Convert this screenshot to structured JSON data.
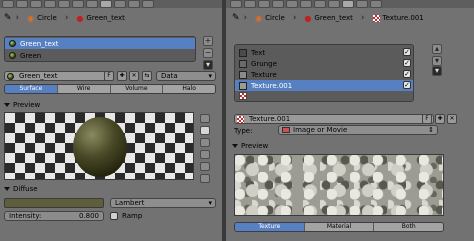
{
  "left_panel": {
    "breadcrumb": {
      "object": "Circle",
      "material": "Green_text"
    },
    "material_slots": [
      {
        "name": "Green_text",
        "selected": true
      },
      {
        "name": "Green",
        "selected": false
      }
    ],
    "material_field": {
      "name": "Green_text",
      "fake_user_label": "F",
      "data_dropdown": "Data"
    },
    "render_tabs": [
      "Surface",
      "Wire",
      "Volume",
      "Halo"
    ],
    "active_render_tab": "Surface",
    "preview_section": "Preview",
    "diffuse_section": "Diffuse",
    "diffuse_shader": "Lambert",
    "intensity_label": "Intensity:",
    "intensity_value": "0.800",
    "ramp_label": "Ramp",
    "diffuse_color": "#5e5e3c"
  },
  "right_panel": {
    "breadcrumb": {
      "object": "Circle",
      "material": "Green_text",
      "texture": "Texture.001"
    },
    "texture_slots": [
      {
        "name": "Text",
        "checked": true,
        "selected": false
      },
      {
        "name": "Grunge",
        "checked": true,
        "selected": false
      },
      {
        "name": "Texture",
        "checked": true,
        "selected": false
      },
      {
        "name": "Texture.001",
        "checked": true,
        "selected": true
      }
    ],
    "texture_field": {
      "name": "Texture.001",
      "fake_user_label": "F"
    },
    "type_label": "Type:",
    "type_value": "Image or Movie",
    "preview_section": "Preview",
    "preview_tabs": [
      "Texture",
      "Material",
      "Both"
    ],
    "active_preview_tab": "Texture"
  },
  "colors": {
    "selection": "#5680c2",
    "panel_bg": "#727272"
  }
}
